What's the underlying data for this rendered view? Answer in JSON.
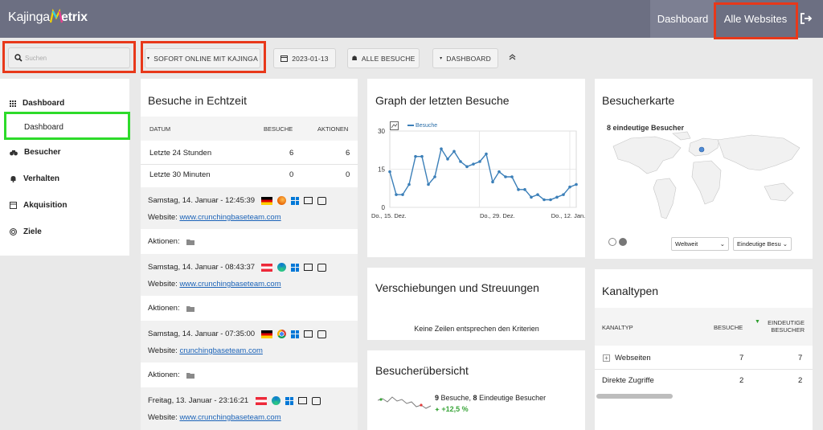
{
  "header": {
    "logo_prefix": "Kajinga",
    "logo_suffix": "etrix",
    "nav_dashboard": "Dashboard",
    "nav_all_websites": "Alle Websites"
  },
  "toolbar": {
    "search_placeholder": "Suchen",
    "site_button": "SOFORT ONLINE MIT KAJINGA",
    "date_button": "2023-01-13",
    "segment_button": "ALLE BESUCHE",
    "dashboard_button": "DASHBOARD"
  },
  "sidebar": {
    "items": [
      {
        "label": "Dashboard",
        "icon": "grid-icon"
      },
      {
        "label": "Besucher",
        "icon": "binoculars-icon"
      },
      {
        "label": "Verhalten",
        "icon": "bell-icon"
      },
      {
        "label": "Akquisition",
        "icon": "window-icon"
      },
      {
        "label": "Ziele",
        "icon": "target-icon"
      }
    ],
    "sub_dashboard": "Dashboard"
  },
  "realtime": {
    "title": "Besuche in Echtzeit",
    "columns": [
      "DATUM",
      "BESUCHE",
      "AKTIONEN"
    ],
    "rows": [
      {
        "label": "Letzte 24 Stunden",
        "visits": "6",
        "actions": "6"
      },
      {
        "label": "Letzte 30 Minuten",
        "visits": "0",
        "actions": "0"
      }
    ],
    "visits": [
      {
        "when": "Samstag, 14. Januar - 12:45:39",
        "site_label": "Website: ",
        "site": "www.crunchingbaseteam.com",
        "actions_label": "Aktionen:"
      },
      {
        "when": "Samstag, 14. Januar - 08:43:37",
        "site_label": "Website: ",
        "site": "www.crunchingbaseteam.com",
        "actions_label": "Aktionen:"
      },
      {
        "when": "Samstag, 14. Januar - 07:35:00",
        "site_label": "Website: ",
        "site": "crunchingbaseteam.com",
        "actions_label": "Aktionen:"
      },
      {
        "when": "Freitag, 13. Januar - 23:16:21",
        "site_label": "Website: ",
        "site": "www.crunchingbaseteam.com"
      }
    ]
  },
  "graph": {
    "title": "Graph der letzten Besuche",
    "chart_data": {
      "type": "line",
      "series": [
        {
          "name": "Besuche",
          "values": [
            14,
            5,
            5,
            9,
            20,
            20,
            9,
            12,
            23,
            19,
            22,
            18,
            16,
            17,
            18,
            21,
            10,
            14,
            12,
            12,
            7,
            7,
            4,
            5,
            3,
            3,
            4,
            5,
            8,
            9
          ]
        }
      ],
      "ylim": [
        0,
        30
      ],
      "yticks": [
        "30",
        "15",
        "0"
      ],
      "xticks": [
        "Do., 15. Dez.",
        "Do., 29. Dez.",
        "Do., 12. Jan."
      ],
      "grid": true,
      "legend": "top-left",
      "color": "#3b7fb8"
    }
  },
  "map": {
    "title": "Besucherkarte",
    "unique_label": "8 eindeutige Besucher",
    "region_select": "Weltweit",
    "metric_select": "Eindeutige Besu"
  },
  "shifts": {
    "title": "Verschiebungen und Streuungen",
    "empty": "Keine Zeilen entsprechen den Kriterien"
  },
  "overview": {
    "title": "Besucherübersicht",
    "visits_num": "9",
    "visits_text": " Besuche, ",
    "unique_num": "8",
    "unique_text": " Eindeutige Besucher",
    "delta": "+12,5 %"
  },
  "channels": {
    "title": "Kanaltypen",
    "columns": [
      "KANALTYP",
      "BESUCHE",
      "EINDEUTIGE BESUCHER"
    ],
    "rows": [
      {
        "label": "Webseiten",
        "visits": "7",
        "unique": "7"
      },
      {
        "label": "Direkte Zugriffe",
        "visits": "2",
        "unique": "2"
      }
    ]
  }
}
